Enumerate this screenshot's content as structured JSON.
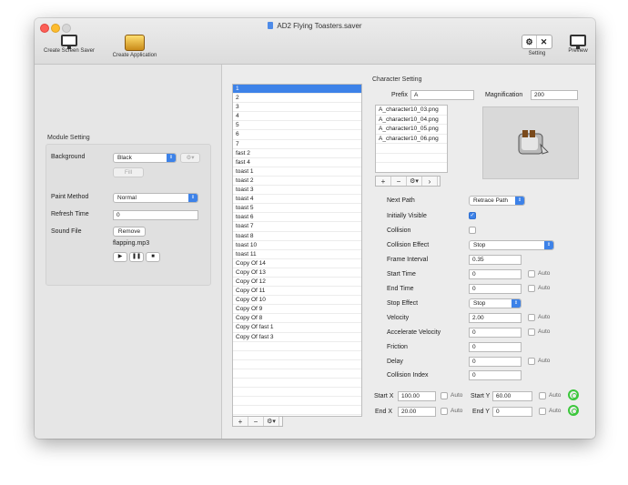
{
  "window": {
    "title": "AD2 Flying Toasters.saver"
  },
  "toolbar": {
    "create_screen_saver": "Create Screen Saver",
    "create_application": "Create Application",
    "setting": "Setting",
    "preview": "Preview"
  },
  "module": {
    "title": "Module Setting",
    "background_label": "Background",
    "background_value": "Black",
    "fill_button": "Fill",
    "paint_method_label": "Paint Method",
    "paint_method_value": "Normal",
    "refresh_time_label": "Refresh Time",
    "refresh_time_value": "0",
    "sound_file_label": "Sound File",
    "remove_button": "Remove",
    "sound_file_name": "flapping.mp3",
    "play_icon": "play-icon",
    "pause_icon": "pause-icon",
    "stop_icon": "stop-icon"
  },
  "characters": {
    "items": [
      "1",
      "2",
      "3",
      "4",
      "5",
      "6",
      "7",
      "fast 2",
      "fast 4",
      "toast 1",
      "toast 2",
      "toast 3",
      "toast 4",
      "toast 5",
      "toast 6",
      "toast 7",
      "toast 8",
      "toast 10",
      "toast 11",
      "Copy Of 14",
      "Copy Of 13",
      "Copy Of 12",
      "Copy Of 11",
      "Copy Of 10",
      "Copy Of 9",
      "Copy Of 8",
      "Copy Of fast 1",
      "Copy Of fast 3"
    ],
    "selected_index": 0
  },
  "character_setting": {
    "title": "Character Setting",
    "prefix_label": "Prefix",
    "prefix_value": "A",
    "magnification_label": "Magnification",
    "magnification_value": "200",
    "files": [
      "A_character10_03.png",
      "A_character10_04.png",
      "A_character10_05.png",
      "A_character10_06.png"
    ],
    "next_path_label": "Next Path",
    "next_path_value": "Retrace Path",
    "initially_visible_label": "Initially Visible",
    "collision_label": "Collision",
    "collision_effect_label": "Collision Effect",
    "collision_effect_value": "Stop",
    "frame_interval_label": "Frame Interval",
    "frame_interval_value": "0.35",
    "start_time_label": "Start Time",
    "start_time_value": "0",
    "end_time_label": "End Time",
    "end_time_value": "0",
    "stop_effect_label": "Stop Effect",
    "stop_effect_value": "Stop",
    "velocity_label": "Velocity",
    "velocity_value": "2.00",
    "accelerate_velocity_label": "Accelerate Velocity",
    "accelerate_velocity_value": "0",
    "friction_label": "Friction",
    "friction_value": "0",
    "delay_label": "Delay",
    "delay_value": "0",
    "collision_index_label": "Collision Index",
    "collision_index_value": "0",
    "auto_label": "Auto",
    "start_x_label": "Start X",
    "start_x_value": "100.00",
    "start_y_label": "Start Y",
    "start_y_value": "60.00",
    "end_x_label": "End X",
    "end_x_value": "20.00",
    "end_y_label": "End Y",
    "end_y_value": "0"
  }
}
